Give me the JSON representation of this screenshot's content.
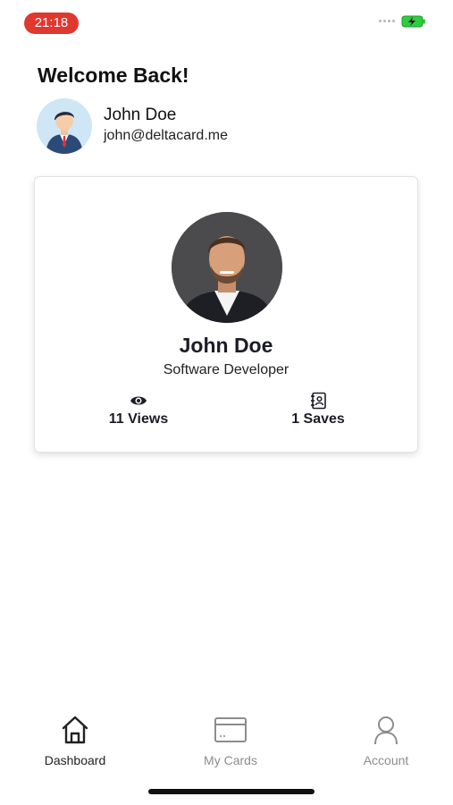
{
  "status_bar": {
    "time": "21:18",
    "time_pill_color": "#e0372f",
    "battery_color": "#2ecc40"
  },
  "header": {
    "welcome": "Welcome Back!",
    "user_name": "John Doe",
    "user_email": "john@deltacard.me"
  },
  "card": {
    "name": "John Doe",
    "title": "Software Developer",
    "views_label": "11 Views",
    "saves_label": "1 Saves",
    "views_icon": "eye-icon",
    "saves_icon": "contact-book-icon"
  },
  "bottom_nav": {
    "items": [
      {
        "label": "Dashboard",
        "icon": "home-icon",
        "active": true
      },
      {
        "label": "My Cards",
        "icon": "card-icon",
        "active": false
      },
      {
        "label": "Account",
        "icon": "person-icon",
        "active": false
      }
    ]
  }
}
